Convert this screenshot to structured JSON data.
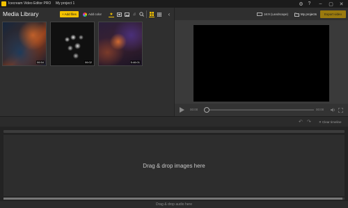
{
  "app": {
    "title": "Icecream Video Editor PRO",
    "project": "My project 1",
    "accent_color": "#f4c200"
  },
  "titlebar": {
    "icons": [
      "settings-icon",
      "help-icon",
      "minimize-icon",
      "maximize-icon",
      "close-icon"
    ]
  },
  "library": {
    "title": "Media Library",
    "add_files_label": "+ Add files",
    "add_color_label": "Add color",
    "filters": [
      "star-icon",
      "video-icon",
      "image-icon",
      "music-icon",
      "search-icon"
    ],
    "active_filter": "star-icon",
    "view_modes": [
      "grid-large-icon",
      "grid-small-icon"
    ],
    "thumbnails": [
      {
        "duration": "06:54"
      },
      {
        "duration": "06:02"
      },
      {
        "duration": "5:46:01"
      }
    ]
  },
  "preview": {
    "aspect_ratio_label": "16:9 (Landscape)",
    "my_projects_label": "My projects",
    "export_label": "Export video",
    "time_current": "00:00",
    "time_total": "00:00"
  },
  "timeline": {
    "clear_label": "Clear timeline",
    "drop_images_label": "Drag & drop images here",
    "drop_audio_label": "Drag & drop audio here"
  }
}
